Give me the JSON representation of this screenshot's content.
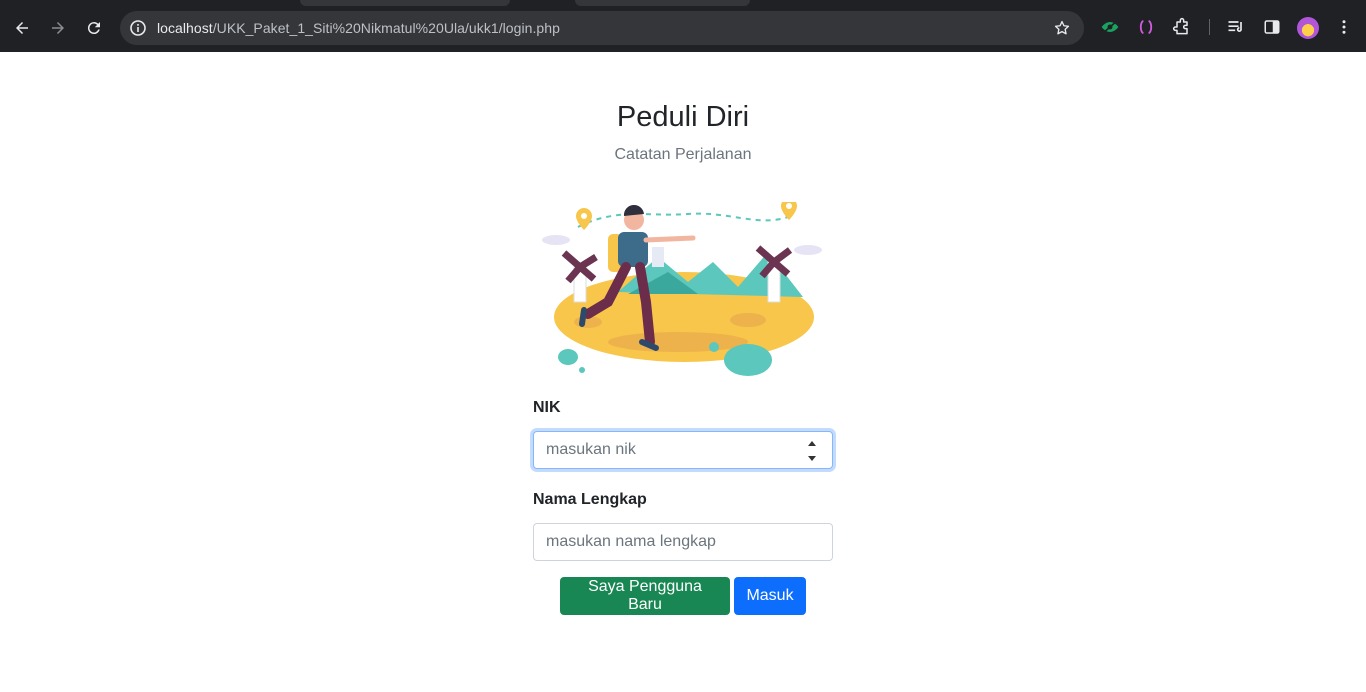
{
  "browser": {
    "url_host": "localhost",
    "url_path": "/UKK_Paket_1_Siti%20Nikmatul%20Ula/ukk1/login.php",
    "icons": [
      "back-icon",
      "forward-icon",
      "reload-icon",
      "site-info-icon",
      "bookmark-star-icon",
      "eye-extension-icon",
      "bracket-extension-icon",
      "extensions-puzzle-icon",
      "reading-list-icon",
      "side-panel-icon",
      "profile-avatar",
      "menu-dots-icon"
    ]
  },
  "page": {
    "title": "Peduli Diri",
    "subtitle": "Catatan Perjalanan",
    "illustration": "traveler-illustration"
  },
  "form": {
    "nik_label": "NIK",
    "nik_placeholder": "masukan nik",
    "name_label": "Nama Lengkap",
    "name_placeholder": "masukan nama lengkap",
    "register_button": "Saya Pengguna Baru",
    "login_button": "Masuk"
  },
  "colors": {
    "chrome_bg": "#202124",
    "omnibox_bg": "#35363a",
    "primary": "#0d6efd",
    "success": "#198754",
    "text": "#212529",
    "muted": "#6c757d"
  }
}
